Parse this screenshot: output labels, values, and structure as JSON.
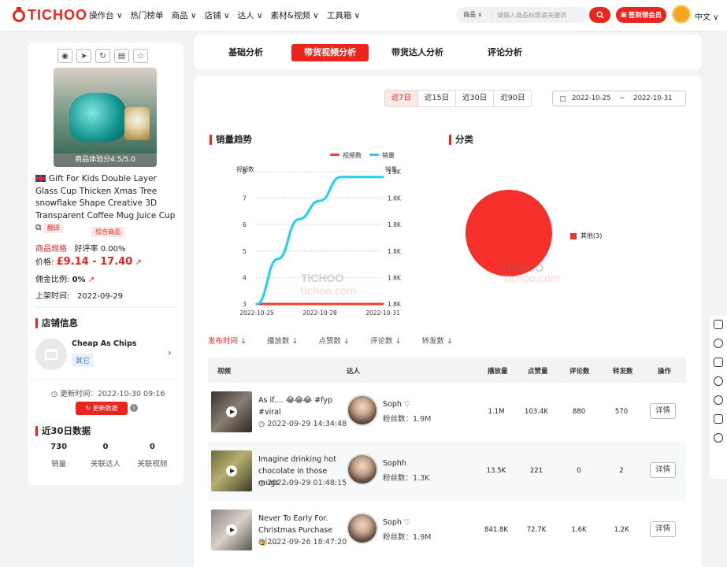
{
  "header": {
    "logo": "TICHOO",
    "nav": [
      "操作台 ∨",
      "热门榜单",
      "商品 ∨",
      "店铺 ∨",
      "达人 ∨",
      "素材&视频 ∨",
      "工具箱 ∨"
    ],
    "search_scope": "商品 ∨",
    "search_placeholder": "请输入商品标题或关键词",
    "vip_label": "签到领会员",
    "language": "中文 ∨"
  },
  "product": {
    "score": "商品体验分4.5/5.0",
    "title": "Gift For Kids Double Layer Glass Cup Thicken Xmas Tree snowflake Shape Creative 3D Transparent Coffee Mug Juice Cup",
    "translate": "翻译",
    "category_tag": "综合商品",
    "spec_label": "商品规格",
    "rating_label": "好评率",
    "rating_value": "0.00%",
    "price_label": "价格:",
    "price_value": "£9.14 - 17.40",
    "commission_label": "佣金比例:",
    "commission_value": "0%",
    "listed_label": "上架时间:",
    "listed_value": "2022-09-29"
  },
  "shop": {
    "section_title": "店铺信息",
    "name": "Cheap As Chips",
    "tag": "其它",
    "updated": "更新时间：2022-10-30 09:16",
    "update_button": "更新数据"
  },
  "stats30": {
    "section_title": "近30日数据",
    "items": [
      {
        "value": "730",
        "label": "销量"
      },
      {
        "value": "0",
        "label": "关联达人"
      },
      {
        "value": "0",
        "label": "关联视频"
      }
    ]
  },
  "tabs": [
    {
      "label": "基础分析",
      "active": false
    },
    {
      "label": "带货视频分析",
      "active": true
    },
    {
      "label": "带货达人分析",
      "active": false
    },
    {
      "label": "评论分析",
      "active": false
    }
  ],
  "range": {
    "buttons": [
      "近7日",
      "近15日",
      "近30日",
      "近90日"
    ],
    "active": "近7日",
    "start": "2022-10-25",
    "sep": "~",
    "end": "2022-10-31"
  },
  "trend": {
    "title": "销量趋势",
    "legend": [
      "视频数",
      "销量"
    ],
    "left_axis_title": "视频数",
    "right_axis_title": "销量"
  },
  "category": {
    "title": "分类",
    "legend": "其他(3)"
  },
  "watermark": {
    "logo": "TICHOO",
    "url": "tichoo.com"
  },
  "chart_data": [
    {
      "type": "line",
      "title": "销量趋势",
      "x": [
        "2022-10-25",
        "2022-10-26",
        "2022-10-27",
        "2022-10-28",
        "2022-10-29",
        "2022-10-30",
        "2022-10-31"
      ],
      "x_tick_labels": [
        "2022-10-25",
        "2022-10-28",
        "2022-10-31"
      ],
      "y_left_ticks": [
        "3",
        "4",
        "5",
        "6",
        "7",
        "8"
      ],
      "y_right_ticks": [
        "1.8K",
        "1.8K",
        "1.8K",
        "1.8K",
        "1.8K",
        "1.8K"
      ],
      "series": [
        {
          "name": "视频数",
          "axis": "left",
          "color": "#f23d2f",
          "values": [
            3,
            3,
            3,
            3,
            3,
            3,
            3
          ]
        },
        {
          "name": "销量",
          "axis": "left-scaled",
          "color": "#1ed2ec",
          "values": [
            3.0,
            4.7,
            6.2,
            6.9,
            7.8,
            7.8,
            7.8
          ]
        }
      ],
      "ylim": [
        3,
        8
      ]
    },
    {
      "type": "pie",
      "title": "分类",
      "labels": [
        "其他(3)"
      ],
      "values": [
        3
      ],
      "colors": [
        "#f5302a"
      ]
    }
  ],
  "sort_fields": [
    "发布时间 ↓",
    "播放数 ↓",
    "点赞数 ↓",
    "评论数 ↓",
    "转发数 ↓"
  ],
  "table": {
    "columns": [
      "视频",
      "达人",
      "播放量",
      "点赞量",
      "评论数",
      "转发数",
      "操作"
    ],
    "rows": [
      {
        "title": "As if.... 😂😂😂 #fyp #viral",
        "time": "◷ 2022-09-29 14:34:48",
        "kol": "Soph ♡",
        "fans": "粉丝数：1.9M",
        "plays": "1.1M",
        "likes": "103.4K",
        "comments": "880",
        "shares": "570",
        "action": "详情"
      },
      {
        "title": "Imagine drinking hot chocolate in those mugs ...",
        "time": "◷ 2022-09-29 01:48:15",
        "kol": "Sophh",
        "fans": "粉丝数：1.3K",
        "plays": "13.5K",
        "likes": "221",
        "comments": "0",
        "shares": "2",
        "action": "详情"
      },
      {
        "title": "Never To Early For. Christmas Purchase 🤯 ...",
        "time": "◷ 2022-09-26 18:47:20",
        "kol": "Soph ♡",
        "fans": "粉丝数：1.9M",
        "plays": "841.8K",
        "likes": "72.7K",
        "comments": "1.6K",
        "shares": "1.2K",
        "action": "详情"
      }
    ]
  }
}
